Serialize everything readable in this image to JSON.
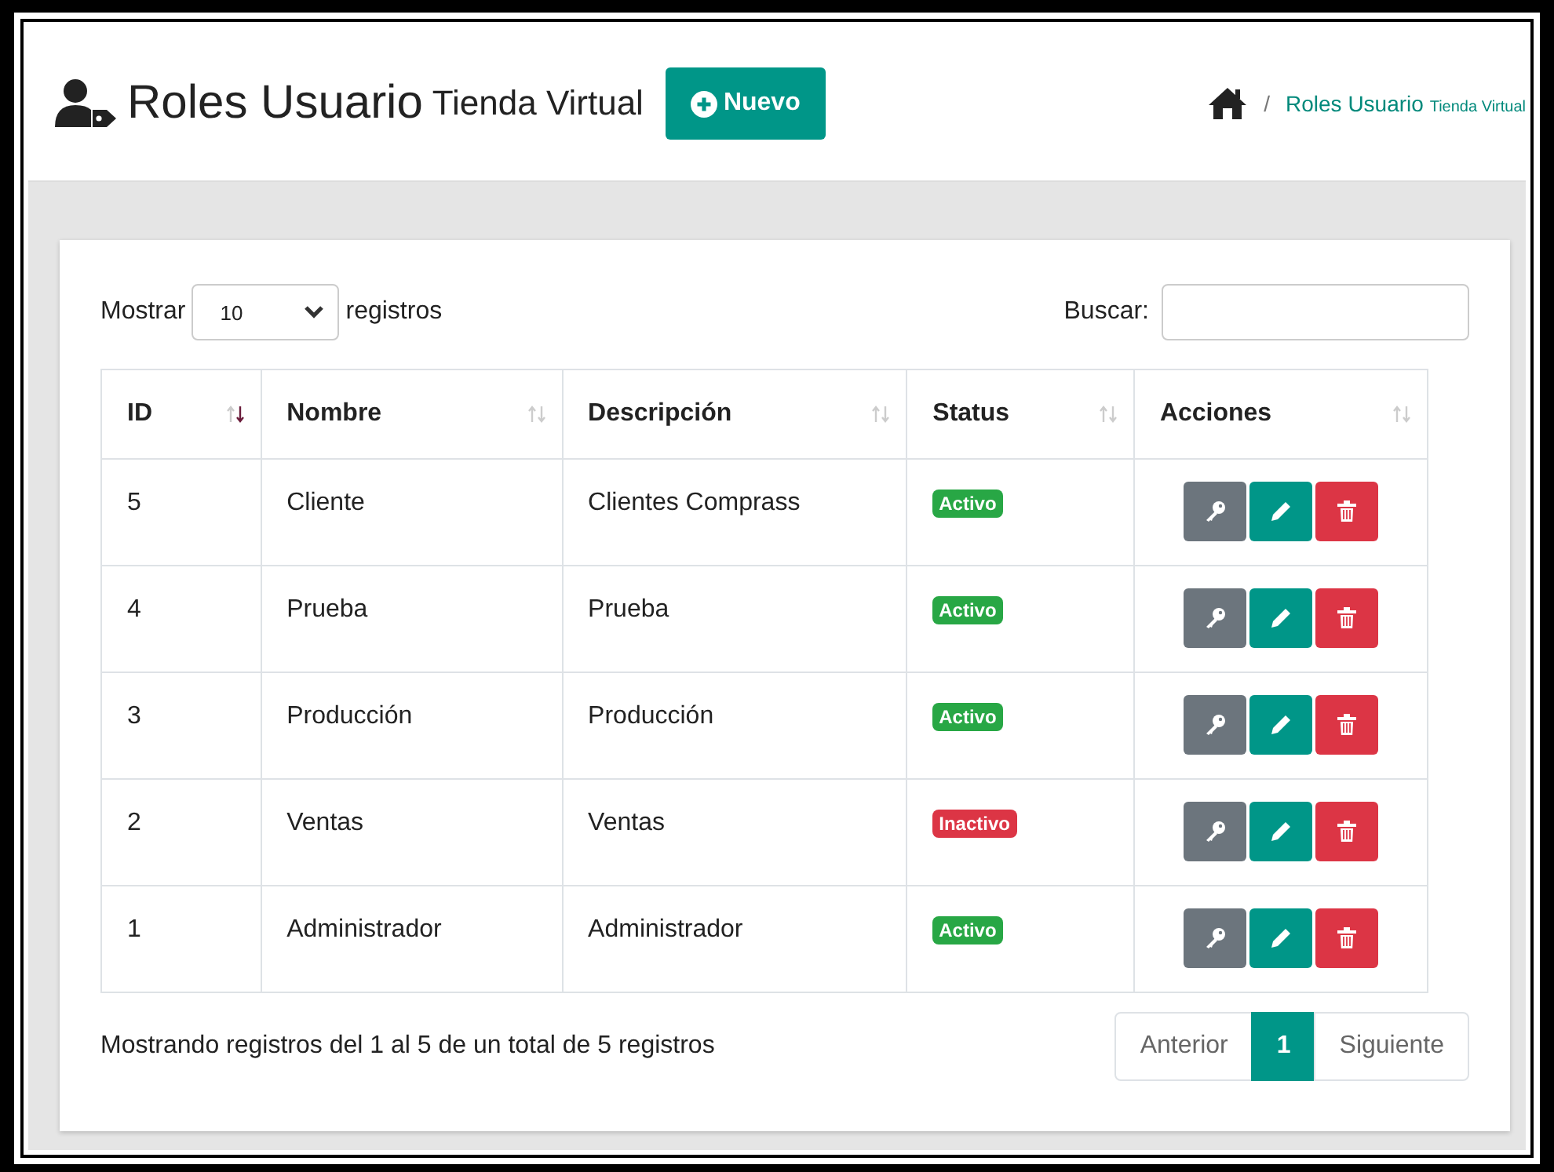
{
  "header": {
    "title": "Roles Usuario",
    "subtitle": "Tienda Virtual",
    "new_button": "Nuevo",
    "breadcrumb": {
      "separator": "/",
      "current": "Roles Usuario",
      "current_small": "Tienda Virtual"
    }
  },
  "controls": {
    "show_label": "Mostrar",
    "page_size": "10",
    "records_label": "registros",
    "search_label": "Buscar:"
  },
  "table": {
    "columns": [
      {
        "label": "ID",
        "sorted": true
      },
      {
        "label": "Nombre",
        "sorted": false
      },
      {
        "label": "Descripción",
        "sorted": false
      },
      {
        "label": "Status",
        "sorted": false
      },
      {
        "label": "Acciones",
        "sorted": false
      }
    ],
    "rows": [
      {
        "id": "5",
        "name": "Cliente",
        "description": "Clientes Comprass",
        "status": "Activo",
        "active": true
      },
      {
        "id": "4",
        "name": "Prueba",
        "description": "Prueba",
        "status": "Activo",
        "active": true
      },
      {
        "id": "3",
        "name": "Producción",
        "description": "Producción",
        "status": "Activo",
        "active": true
      },
      {
        "id": "2",
        "name": "Ventas",
        "description": "Ventas",
        "status": "Inactivo",
        "active": false
      },
      {
        "id": "1",
        "name": "Administrador",
        "description": "Administrador",
        "status": "Activo",
        "active": true
      }
    ]
  },
  "footer": {
    "info": "Mostrando registros del 1 al 5 de un total de 5 registros",
    "pages": [
      {
        "label": "Anterior",
        "selected": false
      },
      {
        "label": "1",
        "selected": true
      },
      {
        "label": "Siguiente",
        "selected": false
      }
    ]
  }
}
